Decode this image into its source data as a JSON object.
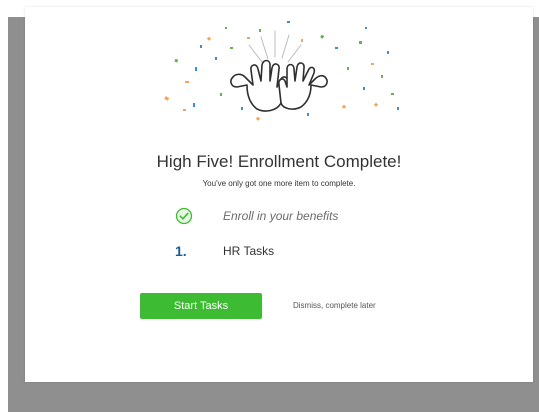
{
  "modal": {
    "title": "High Five! Enrollment Complete!",
    "subtitle": "You've only got one more item to complete."
  },
  "tasks": [
    {
      "label": "Enroll in your benefits",
      "status": "complete",
      "icon": "check-circle-icon"
    },
    {
      "number": "1.",
      "label": "HR Tasks",
      "status": "pending"
    }
  ],
  "actions": {
    "start_label": "Start Tasks",
    "dismiss_label": "Dismiss, complete later"
  },
  "colors": {
    "primary_button": "#3dbb32",
    "check": "#3dbb32",
    "step_number": "#1a5e94",
    "overlay": "#8f8f8f"
  }
}
